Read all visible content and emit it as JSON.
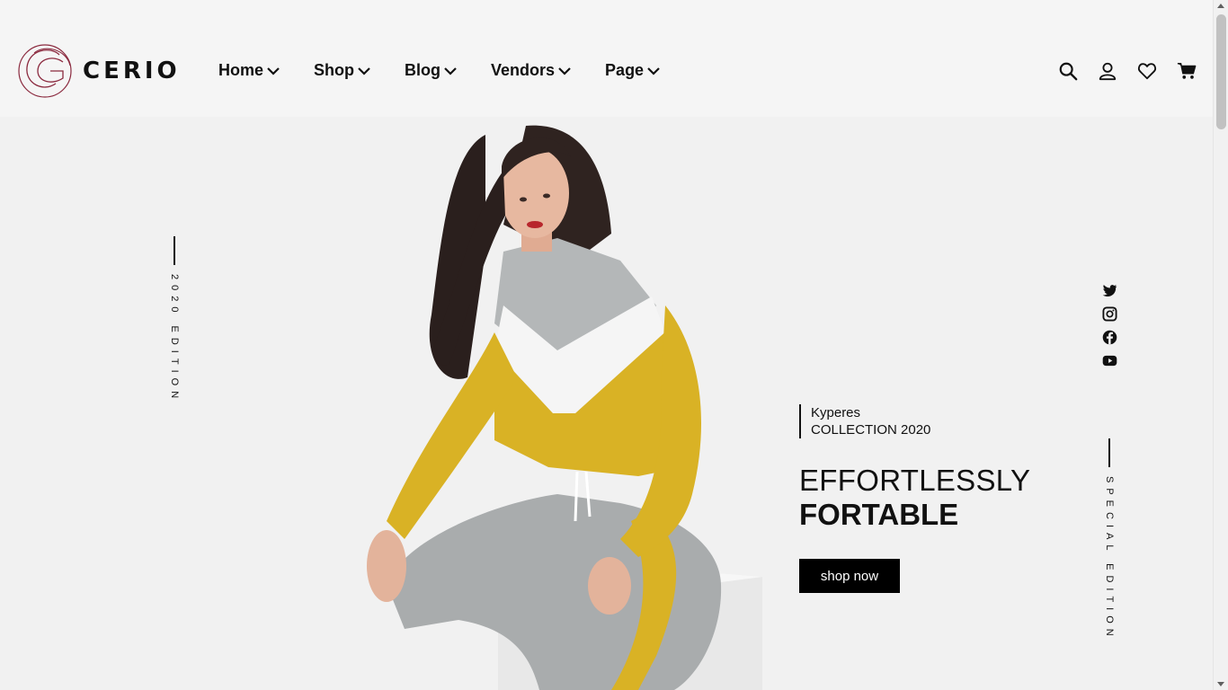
{
  "brand": {
    "name": "CERIO",
    "logo_icon": "cerio-logo-icon",
    "logo_color": "#8b2a3f"
  },
  "nav": {
    "items": [
      {
        "label": "Home"
      },
      {
        "label": "Shop"
      },
      {
        "label": "Blog"
      },
      {
        "label": "Vendors"
      },
      {
        "label": "Page"
      }
    ]
  },
  "header_icons": [
    "search-icon",
    "user-icon",
    "heart-icon",
    "cart-icon"
  ],
  "hero": {
    "left_vertical_text": "2020 EDITION",
    "right_vertical_text": "SPECIAL EDITION",
    "caption_line1": "Kyperes",
    "caption_line2": "COLLECTION 2020",
    "headline_light": "EFFORTLESSLY",
    "headline_bold": "FORTABLE",
    "cta_label": "shop now",
    "socials": [
      "twitter-icon",
      "instagram-icon",
      "facebook-icon",
      "youtube-icon"
    ]
  },
  "colors": {
    "accent": "#000000",
    "background": "#f1f1f1",
    "header_bg": "#f5f5f5",
    "jacket_yellow": "#d9b225"
  }
}
